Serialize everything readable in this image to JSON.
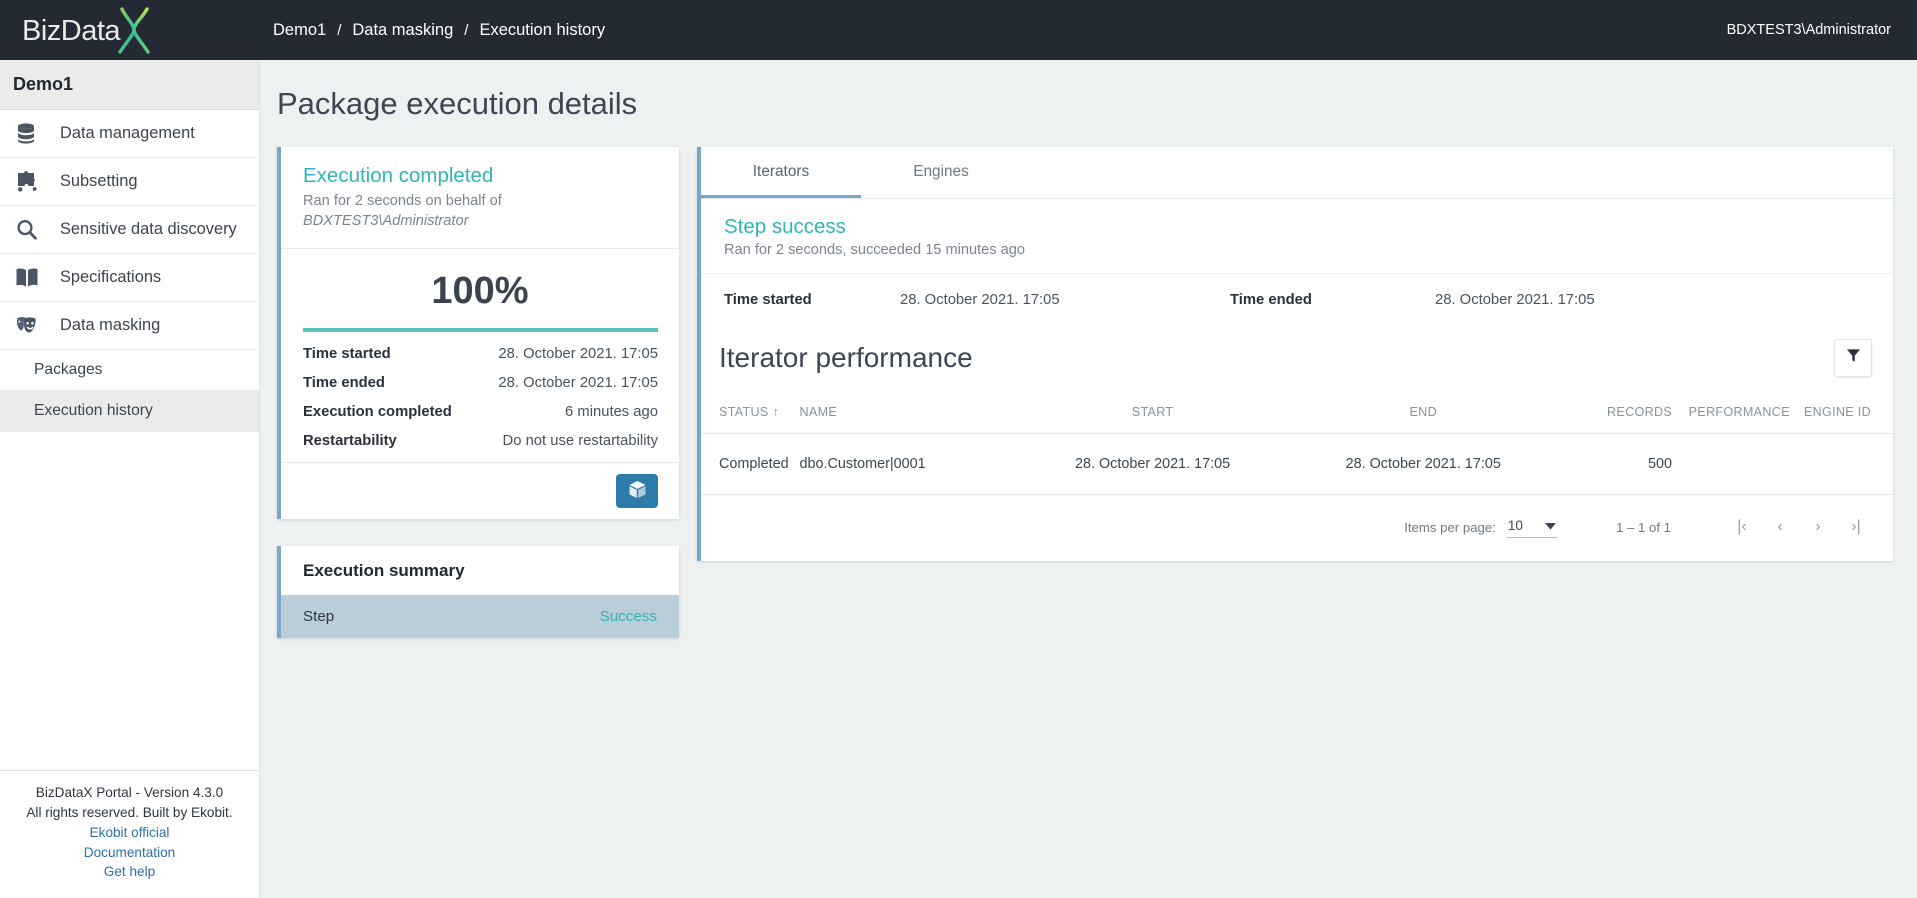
{
  "topbar": {
    "logo_text": "BizData",
    "logo_x": "X",
    "breadcrumb": [
      "Demo1",
      "Data masking",
      "Execution history"
    ],
    "separator": "/",
    "user": "BDXTEST3\\Administrator"
  },
  "sidebar": {
    "title": "Demo1",
    "items": [
      {
        "label": "Data management",
        "icon": "database-icon"
      },
      {
        "label": "Subsetting",
        "icon": "puzzle-piece-icon"
      },
      {
        "label": "Sensitive data discovery",
        "icon": "search-icon"
      },
      {
        "label": "Specifications",
        "icon": "book-icon"
      },
      {
        "label": "Data masking",
        "icon": "theater-masks-icon"
      }
    ],
    "subitems": [
      {
        "label": "Packages",
        "active": false
      },
      {
        "label": "Execution history",
        "active": true
      }
    ]
  },
  "footer": {
    "line1": "BizDataX Portal - Version 4.3.0",
    "line2": "All rights reserved. Built by Ekobit.",
    "links": [
      "Ekobit official",
      "Documentation",
      "Get help"
    ]
  },
  "main": {
    "page_title": "Package execution details"
  },
  "execution_card": {
    "status": "Execution completed",
    "subtitle_line1": "Ran for 2 seconds on behalf of",
    "subtitle_line2": "BDXTEST3\\Administrator",
    "progress_text": "100%",
    "progress_percent": 100,
    "details": [
      {
        "label": "Time started",
        "value": "28. October 2021. 17:05"
      },
      {
        "label": "Time ended",
        "value": "28. October 2021. 17:05"
      },
      {
        "label": "Execution completed",
        "value": "6 minutes ago"
      },
      {
        "label": "Restartability",
        "value": "Do not use restartability"
      }
    ],
    "action_icon": "package-box-icon"
  },
  "summary_card": {
    "title": "Execution summary",
    "rows": [
      {
        "label": "Step",
        "value": "Success"
      }
    ]
  },
  "right_panel": {
    "tabs": [
      {
        "label": "Iterators",
        "active": true
      },
      {
        "label": "Engines",
        "active": false
      }
    ],
    "step": {
      "title": "Step success",
      "subtitle": "Ran for 2 seconds, succeeded 15 minutes ago",
      "time_started_label": "Time started",
      "time_started_value": "28. October 2021. 17:05",
      "time_ended_label": "Time ended",
      "time_ended_value": "28. October 2021. 17:05"
    },
    "table": {
      "title": "Iterator performance",
      "filter_icon": "filter-icon",
      "sort_indicator": "↑",
      "columns": [
        "STATUS",
        "NAME",
        "START",
        "END",
        "RECORDS",
        "PERFORMANCE",
        "ENGINE ID"
      ],
      "rows": [
        {
          "status": "Completed",
          "name": "dbo.Customer|0001",
          "start": "28. October 2021. 17:05",
          "end": "28. October 2021. 17:05",
          "records": "500",
          "performance": "",
          "engine_id": ""
        }
      ]
    },
    "paginator": {
      "items_per_page_label": "Items per page:",
      "items_per_page_value": "10",
      "range": "1 – 1 of 1",
      "first": "|‹",
      "prev": "‹",
      "next": "›",
      "last": "›|"
    }
  },
  "colors": {
    "topbar_bg": "#242a33",
    "accent_teal": "#2fb5bb",
    "progress_teal": "#5bc4bf",
    "card_border": "#7aa7c7",
    "button_blue": "#2d7bab",
    "summary_row_bg": "#b9ced9"
  }
}
